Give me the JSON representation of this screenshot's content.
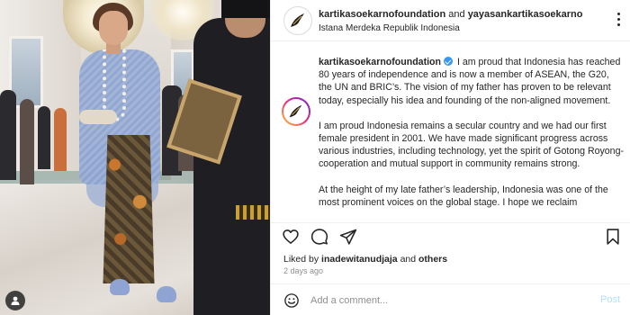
{
  "header": {
    "author": "kartikasoekarnofoundation",
    "conjunction": "and",
    "coauthor": "yayasankartikasoekarno",
    "location": "Istana Merdeka Republik Indonesia"
  },
  "caption": {
    "username": "kartikasoekarnofoundation",
    "paragraphs": [
      "I am proud that Indonesia has reached 80 years of independence and is now a member of ASEAN, the G20, the UN and BRIC’s. The vision of my father has proven to be relevant today, especially his idea and founding of the non-aligned movement.",
      "I am proud Indonesia remains a secular country and we had our first female president in 2001. We have made significant progress across various industries, including technology, yet the spirit of Gotong Royong-cooperation and mutual support in community remains strong.",
      "At the height of my late father’s leadership, Indonesia was one of the most prominent voices on the global stage. I hope we reclaim"
    ]
  },
  "likes": {
    "prefix": "Liked by",
    "user": "inadewitanudjaja",
    "and": "and",
    "others": "others"
  },
  "timestamp": "2 days ago",
  "comment": {
    "placeholder": "Add a comment...",
    "post_label": "Post"
  },
  "icons": {
    "like": "heart-icon",
    "comment": "comment-icon",
    "share": "share-icon",
    "save": "bookmark-icon",
    "emoji": "emoji-icon",
    "more": "more-options-icon",
    "tagged_user": "user-icon"
  },
  "colors": {
    "verified": "#3897f0",
    "post_button": "#b2dffc",
    "muted_text": "#8e8e8e",
    "text": "#262626"
  }
}
